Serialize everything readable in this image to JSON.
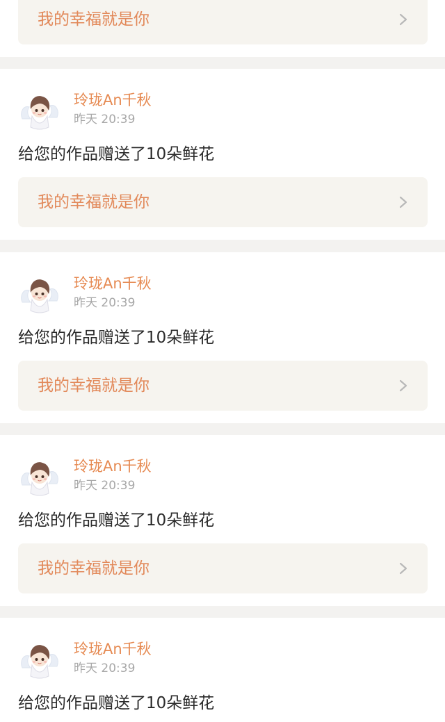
{
  "feed": {
    "items": [
      {
        "work_title": "我的幸福就是你"
      },
      {
        "user_name": "玲珑An千秋",
        "time": "昨天 20:39",
        "action_text": "给您的作品赠送了10朵鲜花",
        "work_title": "我的幸福就是你"
      },
      {
        "user_name": "玲珑An千秋",
        "time": "昨天 20:39",
        "action_text": "给您的作品赠送了10朵鲜花",
        "work_title": "我的幸福就是你"
      },
      {
        "user_name": "玲珑An千秋",
        "time": "昨天 20:39",
        "action_text": "给您的作品赠送了10朵鲜花",
        "work_title": "我的幸福就是你"
      },
      {
        "user_name": "玲珑An千秋",
        "time": "昨天 20:39",
        "action_text": "给您的作品赠送了10朵鲜花"
      }
    ]
  },
  "colors": {
    "accent": "#e68a52",
    "page_background": "#f3f2f0",
    "card_background": "#ffffff",
    "link_background": "#f6f4ef",
    "muted_text": "#a7a7a7",
    "body_text": "#2a2a2a",
    "pink_mark": "#f06a9a"
  },
  "icons": {
    "avatar": "anime-angel-avatar-icon",
    "chevron": "chevron-right-icon"
  }
}
